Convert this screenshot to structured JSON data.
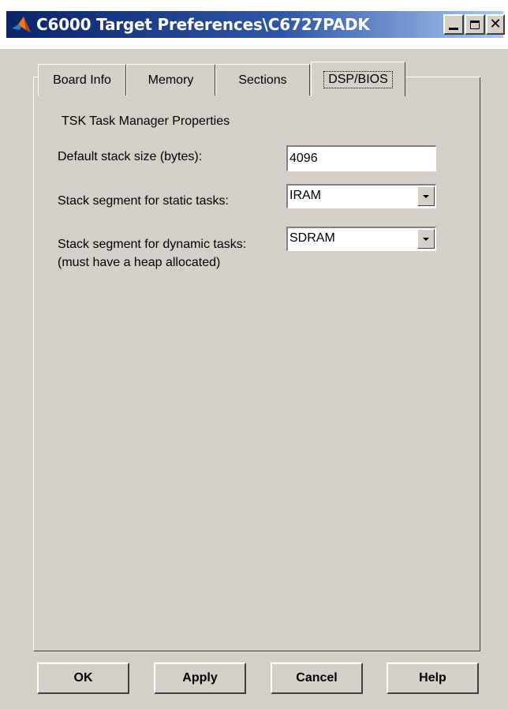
{
  "window": {
    "title": "C6000 Target Preferences\\C6727PADK",
    "icon": "matlab-logo-icon"
  },
  "tabs": [
    {
      "label": "Board Info",
      "active": false
    },
    {
      "label": "Memory",
      "active": false
    },
    {
      "label": "Sections",
      "active": false
    },
    {
      "label": "DSP/BIOS",
      "active": true
    }
  ],
  "content": {
    "section_title": "TSK Task Manager Properties",
    "stack_size_label": "Default stack size (bytes):",
    "stack_size_value": "4096",
    "static_label": "Stack segment for static tasks:",
    "static_value": "IRAM",
    "dynamic_label": "Stack segment for dynamic tasks:",
    "dynamic_note": "(must have a heap allocated)",
    "dynamic_value": "SDRAM"
  },
  "buttons": {
    "ok": "OK",
    "apply": "Apply",
    "cancel": "Cancel",
    "help": "Help"
  }
}
